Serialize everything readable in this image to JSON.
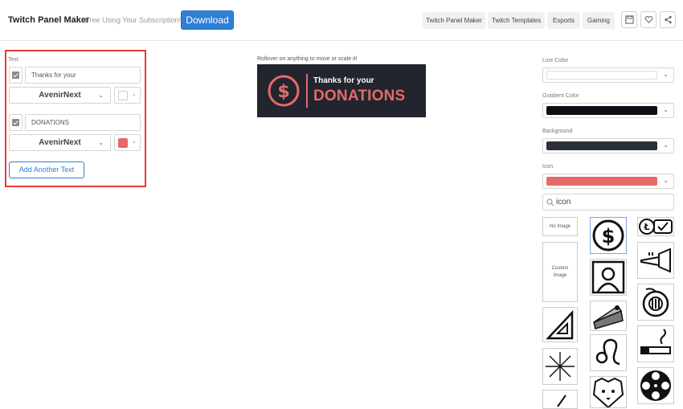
{
  "header": {
    "app_title": "Twitch Panel Maker",
    "subtitle": "Free Using Your Subscription!",
    "download_label": "Download",
    "nav": [
      "Twitch Panel Maker",
      "Twitch Templates",
      "Esports",
      "Gaming"
    ],
    "icons": [
      "save-icon",
      "heart-icon",
      "share-icon"
    ]
  },
  "left": {
    "section_label": "Text",
    "rows": [
      {
        "text": "Thanks for your",
        "font": "AvenirNext",
        "color": "#ffffff"
      },
      {
        "text": "DONATIONS",
        "font": "AvenirNext",
        "color": "#e46a6a"
      }
    ],
    "add_button": "Add Another Text"
  },
  "center": {
    "hint": "Rollover on anything to move or scale it!",
    "preview": {
      "line1": "Thanks for your",
      "line2": "DONATIONS",
      "icon": "dollar-icon"
    }
  },
  "right": {
    "line_color_label": "Line Color",
    "gradient_color_label": "Gradient Color",
    "background_label": "Background",
    "icon_label": "Icon",
    "colors": {
      "line": "#ffffff",
      "gradient": "#0d0f14",
      "background": "#2b2f36",
      "icon": "#e46a6a"
    },
    "search_value": "icon",
    "tiles": {
      "no_image": "No Image",
      "custom_image": "Custom Image"
    }
  }
}
